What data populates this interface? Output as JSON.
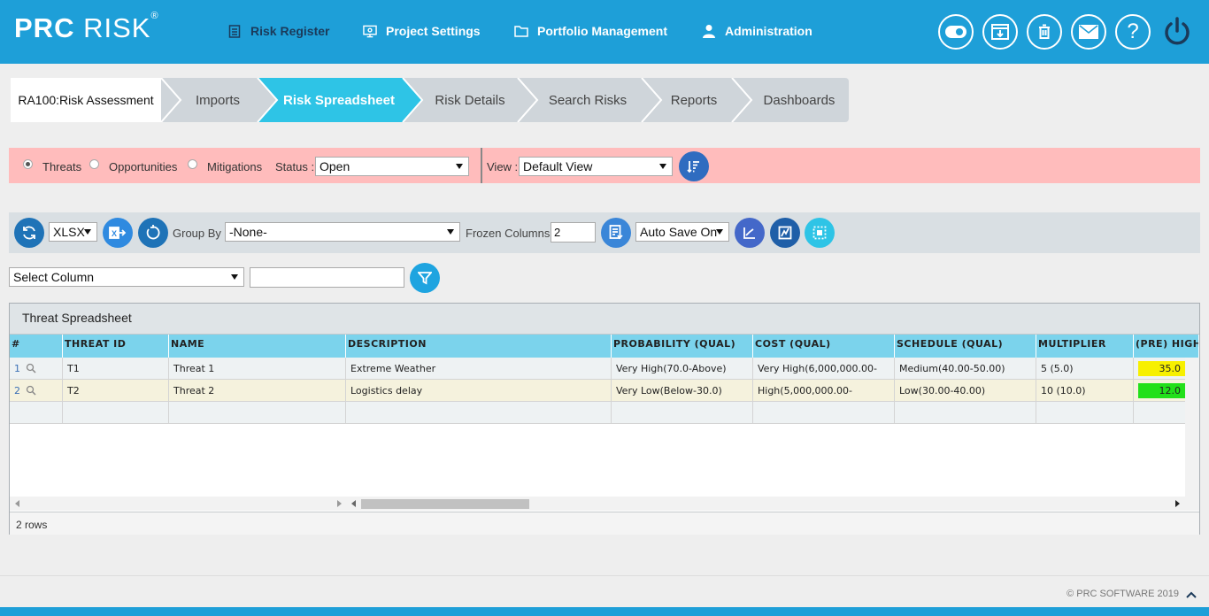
{
  "header": {
    "logo_text_bold": "PRC",
    "logo_text": "RISK",
    "logo_reg": "®",
    "nav": [
      {
        "label": "Risk Register",
        "icon": "document-list-icon",
        "active": true
      },
      {
        "label": "Project Settings",
        "icon": "monitor-settings-icon",
        "active": false
      },
      {
        "label": "Portfolio Management",
        "icon": "folder-icon",
        "active": false
      },
      {
        "label": "Administration",
        "icon": "user-icon",
        "active": false
      }
    ],
    "right_icons": [
      "toggle-icon",
      "download-window-icon",
      "trash-icon",
      "mail-icon",
      "help-icon",
      "power-icon"
    ],
    "help_glyph": "?"
  },
  "steps": {
    "project": "RA100:Risk Assessment",
    "items": [
      "Imports",
      "Risk Spreadsheet",
      "Risk Details",
      "Search Risks",
      "Reports",
      "Dashboards"
    ],
    "active": "Risk Spreadsheet"
  },
  "filter": {
    "radios": [
      {
        "label": "Threats",
        "checked": true
      },
      {
        "label": "Opportunities",
        "checked": false
      },
      {
        "label": "Mitigations",
        "checked": false
      }
    ],
    "status_label": "Status :",
    "status_value": "Open",
    "view_label": "View :",
    "view_value": "Default View"
  },
  "toolbar": {
    "format_value": "XLSX",
    "group_by_label": "Group By :",
    "group_by_value": "-None-",
    "frozen_label": "Frozen Columns :",
    "frozen_value": "2",
    "autosave_value": "Auto Save On"
  },
  "column_filter": {
    "select_value": "Select Column",
    "text_value": ""
  },
  "grid": {
    "title": "Threat Spreadsheet",
    "columns": [
      "#",
      "THREAT ID",
      "NAME",
      "DESCRIPTION",
      "PROBABILITY (QUAL)",
      "COST (QUAL)",
      "SCHEDULE (QUAL)",
      "MULTIPLIER",
      "(PRE) HIGH..."
    ],
    "rows": [
      {
        "num": "1",
        "id": "T1",
        "name": "Threat 1",
        "description": "Extreme Weather",
        "probability": "Very High(70.0-Above)",
        "cost": "Very High(6,000,000.00-",
        "schedule": "Medium(40.00-50.00)",
        "multiplier": "5 (5.0)",
        "pre_high": "35.0",
        "pre_high_color": "#f7f000"
      },
      {
        "num": "2",
        "id": "T2",
        "name": "Threat 2",
        "description": "Logistics delay",
        "probability": "Very Low(Below-30.0)",
        "cost": "High(5,000,000.00-",
        "schedule": "Low(30.00-40.00)",
        "multiplier": "10 (10.0)",
        "pre_high": "12.0",
        "pre_high_color": "#22e01a"
      }
    ],
    "row_count": "2 rows"
  },
  "footer": {
    "copyright": "© PRC SOFTWARE 2019"
  },
  "colors": {
    "header": "#1e9fd8",
    "active_step": "#2ec4e6",
    "filter_bg": "#ffbcbc",
    "grid_head": "#7bd3ec",
    "row2_bg": "#f5f2dd"
  }
}
